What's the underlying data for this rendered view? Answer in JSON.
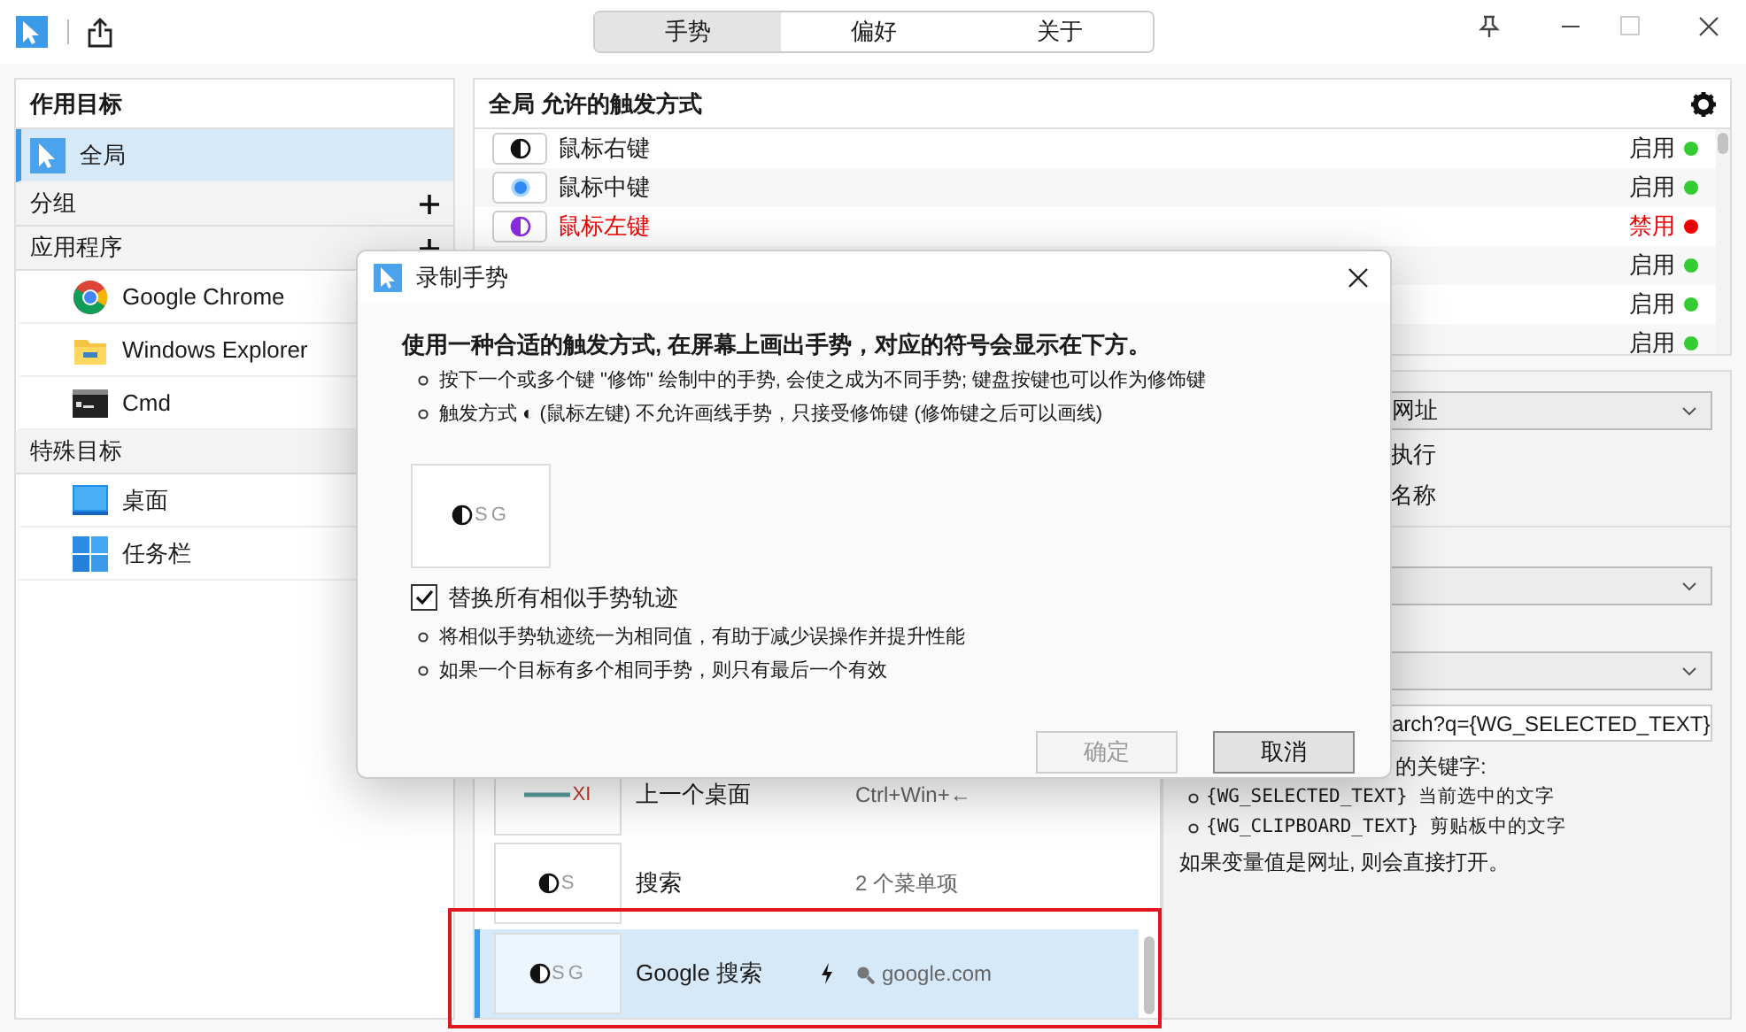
{
  "title_bar": {
    "tabs": [
      {
        "label": "手势",
        "selected": true
      },
      {
        "label": "偏好",
        "selected": false
      },
      {
        "label": "关于",
        "selected": false
      }
    ]
  },
  "targets": {
    "title": "作用目标",
    "items": [
      {
        "kind": "target",
        "label": "全局",
        "selected": true
      },
      {
        "kind": "section",
        "label": "分组",
        "addable": true
      },
      {
        "kind": "section",
        "label": "应用程序",
        "addable": true
      },
      {
        "kind": "target",
        "label": "Google Chrome",
        "selected": false
      },
      {
        "kind": "target",
        "label": "Windows Explorer",
        "selected": false
      },
      {
        "kind": "target",
        "label": "Cmd",
        "selected": false
      },
      {
        "kind": "section",
        "label": "特殊目标"
      },
      {
        "kind": "target",
        "label": "桌面",
        "selected": false
      },
      {
        "kind": "target",
        "label": "任务栏",
        "selected": false
      }
    ]
  },
  "triggers": {
    "title": "全局 允许的触发方式",
    "rows": [
      {
        "label": "鼠标右键",
        "status": "启用",
        "enabled": true
      },
      {
        "label": "鼠标中键",
        "status": "启用",
        "enabled": true
      },
      {
        "label": "鼠标左键",
        "status": "禁用",
        "enabled": false
      },
      {
        "status": "启用",
        "enabled": true
      },
      {
        "status": "启用",
        "enabled": true
      },
      {
        "status": "启用",
        "enabled": true
      }
    ]
  },
  "gestures": [
    {
      "kind": "stroke",
      "symbol": "XI",
      "name": "上一个桌面",
      "detail": "Ctrl+Win+←",
      "link": false,
      "selected": false
    },
    {
      "kind": "trigger",
      "symbol": "S",
      "name": "搜索",
      "detail": "2 个菜单项",
      "link": false,
      "selected": false
    },
    {
      "kind": "trigger",
      "symbol": "SG",
      "name": "Google 搜索",
      "detail": "google.com",
      "link": true,
      "selected": true
    }
  ],
  "command": {
    "action_select": "网址",
    "option_1": "执行",
    "option_2": "名称",
    "url_value": "arch?q={WG_SELECTED_TEXT}",
    "help_title": "的关键字:",
    "help_items": [
      "{WG_SELECTED_TEXT} 当前选中的文字",
      "{WG_CLIPBOARD_TEXT} 剪贴板中的文字"
    ],
    "help_footer": "如果变量值是网址, 则会直接打开。"
  },
  "dialog": {
    "title": "录制手势",
    "heading": "使用一种合适的触发方式, 在屏幕上画出手势，对应的符号会显示在下方。",
    "notes": [
      "按下一个或多个键 \"修饰\" 绘制中的手势, 会使之成为不同手势; 键盘按键也可以作为修饰键",
      "触发方式 ◐ (鼠标左键) 不允许画线手势，只接受修饰键 (修饰键之后可以画线)"
    ],
    "preview_symbol": "SG",
    "checkbox": {
      "label": "替换所有相似手势轨迹",
      "checked": true
    },
    "checkbox_notes": [
      "将相似手势轨迹统一为相同值，有助于减少误操作并提升性能",
      "如果一个目标有多个相同手势，则只有最后一个有效"
    ],
    "buttons": [
      {
        "label": "确定",
        "disabled": true
      },
      {
        "label": "取消",
        "disabled": false
      }
    ]
  }
}
